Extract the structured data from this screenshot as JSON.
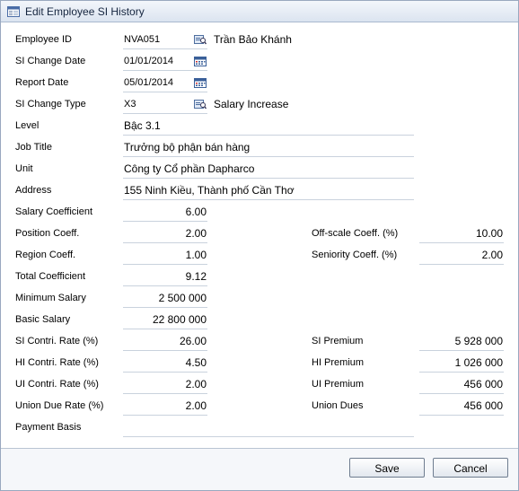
{
  "window": {
    "title": "Edit Employee SI History"
  },
  "fields": {
    "employee_id": {
      "label": "Employee ID",
      "value": "NVA051",
      "desc": "Trần Bảo Khánh"
    },
    "si_change_date": {
      "label": "SI Change Date",
      "value": "01/01/2014"
    },
    "report_date": {
      "label": "Report Date",
      "value": "05/01/2014"
    },
    "si_change_type": {
      "label": "SI Change Type",
      "value": "X3",
      "desc": "Salary Increase"
    },
    "level": {
      "label": "Level",
      "value": "Bậc 3.1"
    },
    "job_title": {
      "label": "Job Title",
      "value": "Trưởng bộ phận bán hàng"
    },
    "unit": {
      "label": "Unit",
      "value": "Công ty Cổ phần Dapharco"
    },
    "address": {
      "label": "Address",
      "value": "155 Ninh Kiều, Thành phố Cần Thơ"
    },
    "salary_coeff": {
      "label": "Salary Coefficient",
      "value": "6.00"
    },
    "position_coeff": {
      "label": "Position Coeff.",
      "value": "2.00"
    },
    "offscale_coeff": {
      "label": "Off-scale Coeff. (%)",
      "value": "10.00"
    },
    "region_coeff": {
      "label": "Region Coeff.",
      "value": "1.00"
    },
    "seniority_coeff": {
      "label": "Seniority Coeff. (%)",
      "value": "2.00"
    },
    "total_coeff": {
      "label": "Total Coefficient",
      "value": "9.12"
    },
    "minimum_salary": {
      "label": "Minimum Salary",
      "value": "2 500 000"
    },
    "basic_salary": {
      "label": "Basic Salary",
      "value": "22 800 000"
    },
    "si_rate": {
      "label": "SI Contri. Rate (%)",
      "value": "26.00"
    },
    "si_premium": {
      "label": "SI Premium",
      "value": "5 928 000"
    },
    "hi_rate": {
      "label": "HI Contri. Rate (%)",
      "value": "4.50"
    },
    "hi_premium": {
      "label": "HI Premium",
      "value": "1 026 000"
    },
    "ui_rate": {
      "label": "UI Contri. Rate (%)",
      "value": "2.00"
    },
    "ui_premium": {
      "label": "UI Premium",
      "value": "456 000"
    },
    "union_rate": {
      "label": "Union Due Rate (%)",
      "value": "2.00"
    },
    "union_dues": {
      "label": "Union Dues",
      "value": "456 000"
    },
    "payment_basis": {
      "label": "Payment Basis",
      "value": ""
    }
  },
  "buttons": {
    "save": "Save",
    "cancel": "Cancel"
  }
}
